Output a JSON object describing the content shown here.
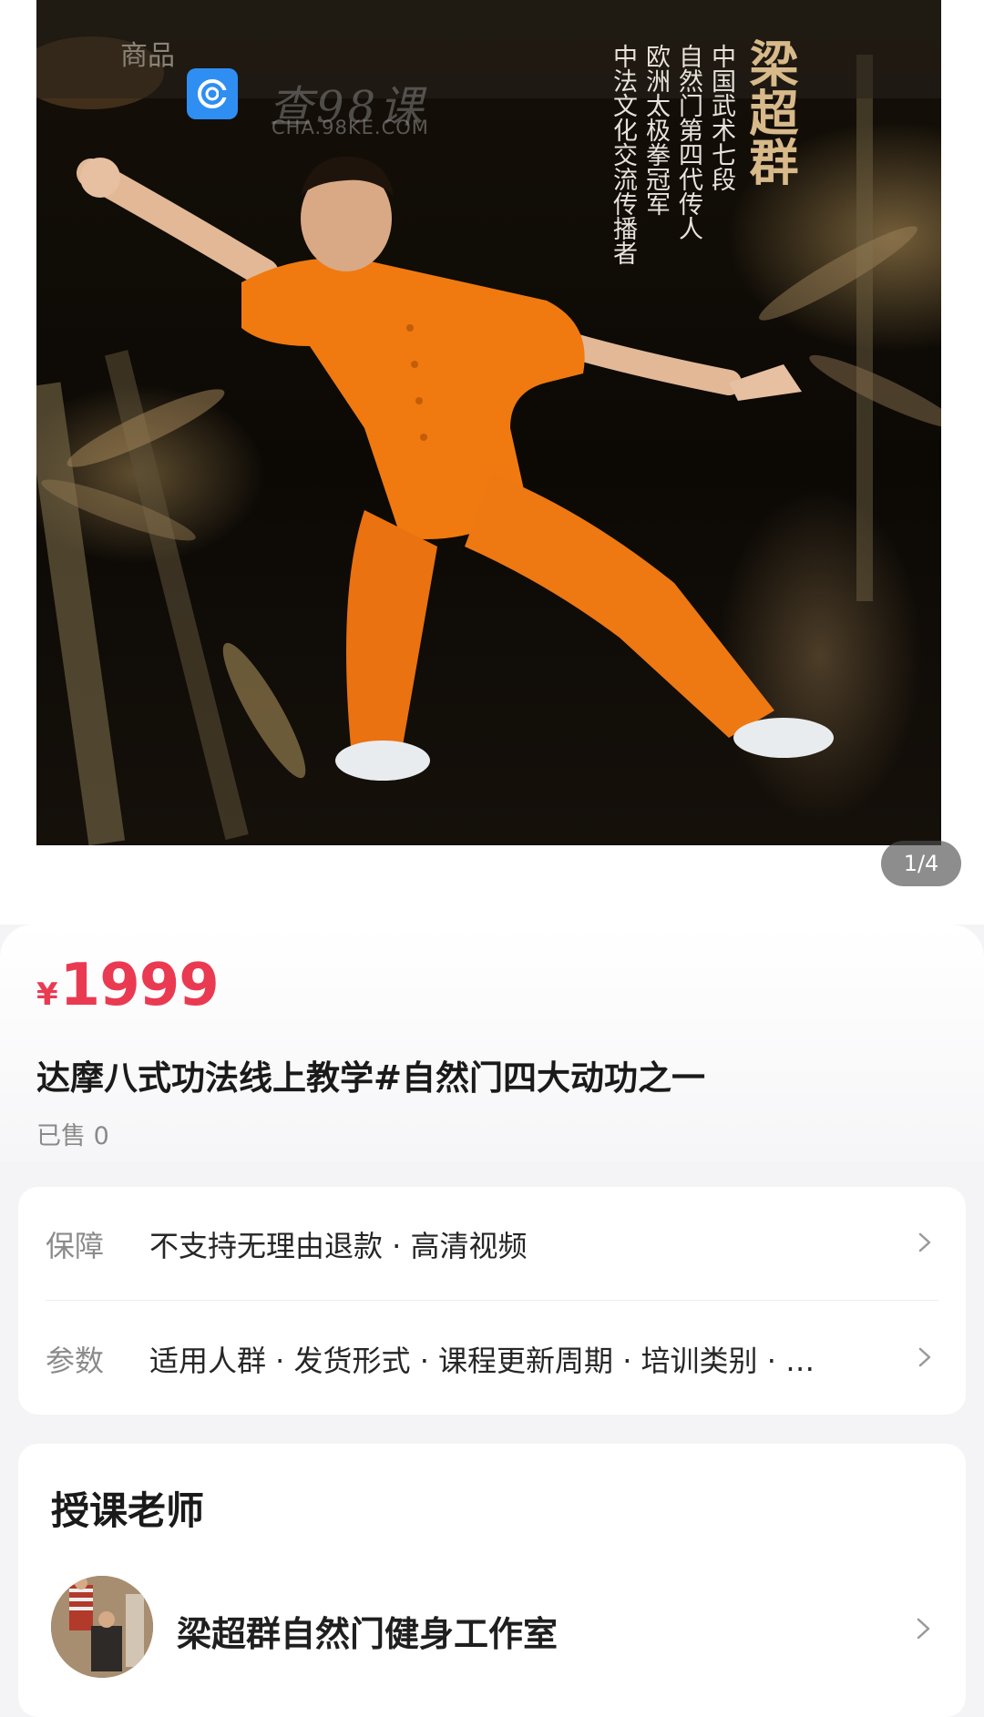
{
  "hero": {
    "topbar_text": "商品",
    "watermark_title": "查98课",
    "watermark_sub": "CHA.98KE.COM",
    "caption_name": "梁超群",
    "caption_lines": [
      "中国武术七段",
      "自然门第四代传人",
      "欧洲太极拳冠军",
      "中法文化交流传播者"
    ],
    "counter": "1/4"
  },
  "product": {
    "currency": "¥",
    "price": "1999",
    "title": "达摩八式功法线上教学#自然门四大动功之一",
    "sold": "已售 0"
  },
  "specs": [
    {
      "key": "保障",
      "value": "不支持无理由退款 · 高清视频"
    },
    {
      "key": "参数",
      "value": "适用人群 · 发货形式 · 课程更新周期 · 培训类别 · …"
    }
  ],
  "teacher": {
    "heading": "授课老师",
    "studio_name": "梁超群自然门健身工作室"
  },
  "colors": {
    "price": "#ea3a52",
    "robe": "#f07a10",
    "background": "#f4f4f6"
  }
}
